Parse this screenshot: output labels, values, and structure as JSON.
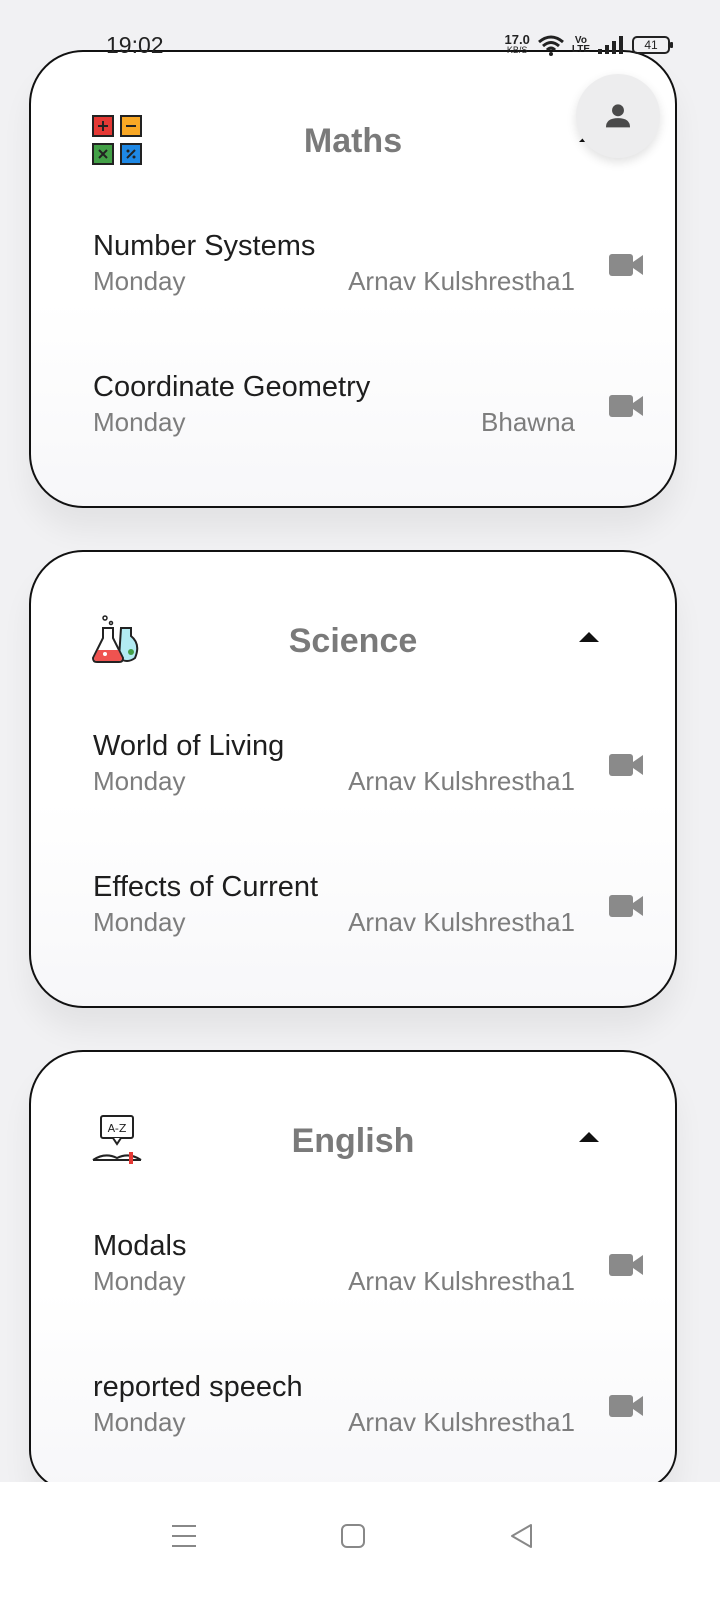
{
  "status_bar": {
    "time": "19:02",
    "net_speed": "17.0",
    "net_unit": "KB/S",
    "volte": "Vo\nLTE",
    "battery": "41"
  },
  "subjects": [
    {
      "name": "Maths",
      "icon": "math-operations-icon",
      "lessons": [
        {
          "title": "Number Systems",
          "day": "Monday",
          "teacher": "Arnav Kulshrestha1"
        },
        {
          "title": "Coordinate Geometry",
          "day": "Monday",
          "teacher": "Bhawna"
        }
      ]
    },
    {
      "name": "Science",
      "icon": "flasks-icon",
      "lessons": [
        {
          "title": "World of Living",
          "day": "Monday",
          "teacher": "Arnav Kulshrestha1"
        },
        {
          "title": "Effects of Current",
          "day": "Monday",
          "teacher": "Arnav Kulshrestha1"
        }
      ]
    },
    {
      "name": "English",
      "icon": "dictionary-icon",
      "icon_text": "A-Z",
      "lessons": [
        {
          "title": "Modals",
          "day": "Monday",
          "teacher": "Arnav Kulshrestha1"
        },
        {
          "title": "reported speech",
          "day": "Monday",
          "teacher": "Arnav Kulshrestha1"
        }
      ]
    }
  ],
  "colors": {
    "title_gray": "#7a7a7a",
    "video_icon_gray": "#8a8a8a",
    "card_border": "#111111"
  }
}
